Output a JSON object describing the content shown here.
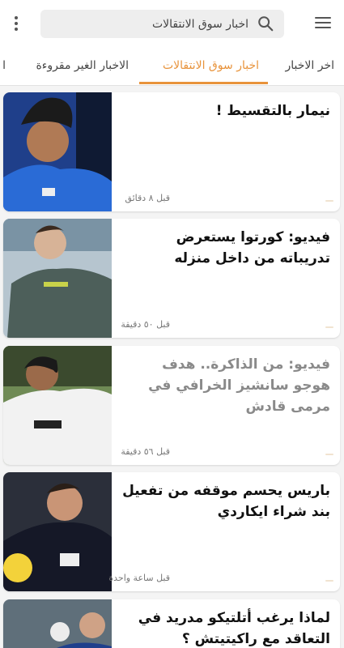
{
  "header": {
    "menu_icon": "hamburger-menu-icon",
    "more_icon": "more-vertical-icon",
    "search": {
      "placeholder": "اخبار سوق الانتقالات",
      "icon": "search-icon"
    }
  },
  "tabs": [
    {
      "label": "اخر الاخبار"
    },
    {
      "label": "اخبار سوق الانتقالات",
      "active": true
    },
    {
      "label": "الاخبار الغير مقروءة"
    },
    {
      "label": "ا"
    }
  ],
  "colors": {
    "accent": "#e8933b",
    "read_title": "#8a8a8a"
  },
  "articles": [
    {
      "title": "نيمار بالتقسيط !",
      "time": "قبل ٨ دقائق",
      "read": false,
      "thumb_icon": "player-photo-psg"
    },
    {
      "title": "فيديو: كورتوا يستعرض تدريباته من داخل منزله",
      "time": "قبل ٥٠ دقيقة",
      "read": false,
      "thumb_icon": "player-photo-real-madrid-keeper"
    },
    {
      "title": "فيديو: من الذاكرة.. هدف هوجو سانشيز الخرافي في مرمى قادش",
      "time": "قبل ٥٦ دقيقة",
      "read": true,
      "thumb_icon": "player-photo-real-madrid-white"
    },
    {
      "title": "باريس يحسم موقفه من تفعيل بند شراء ايكاردي",
      "time": "قبل ساعة واحدة",
      "read": false,
      "thumb_icon": "player-photo-psg-ball"
    },
    {
      "title": "لماذا يرغب أتلتيكو مدريد في التعاقد مع راكيتيتش ؟",
      "time": "",
      "read": false,
      "thumb_icon": "player-photo-barcelona"
    }
  ]
}
